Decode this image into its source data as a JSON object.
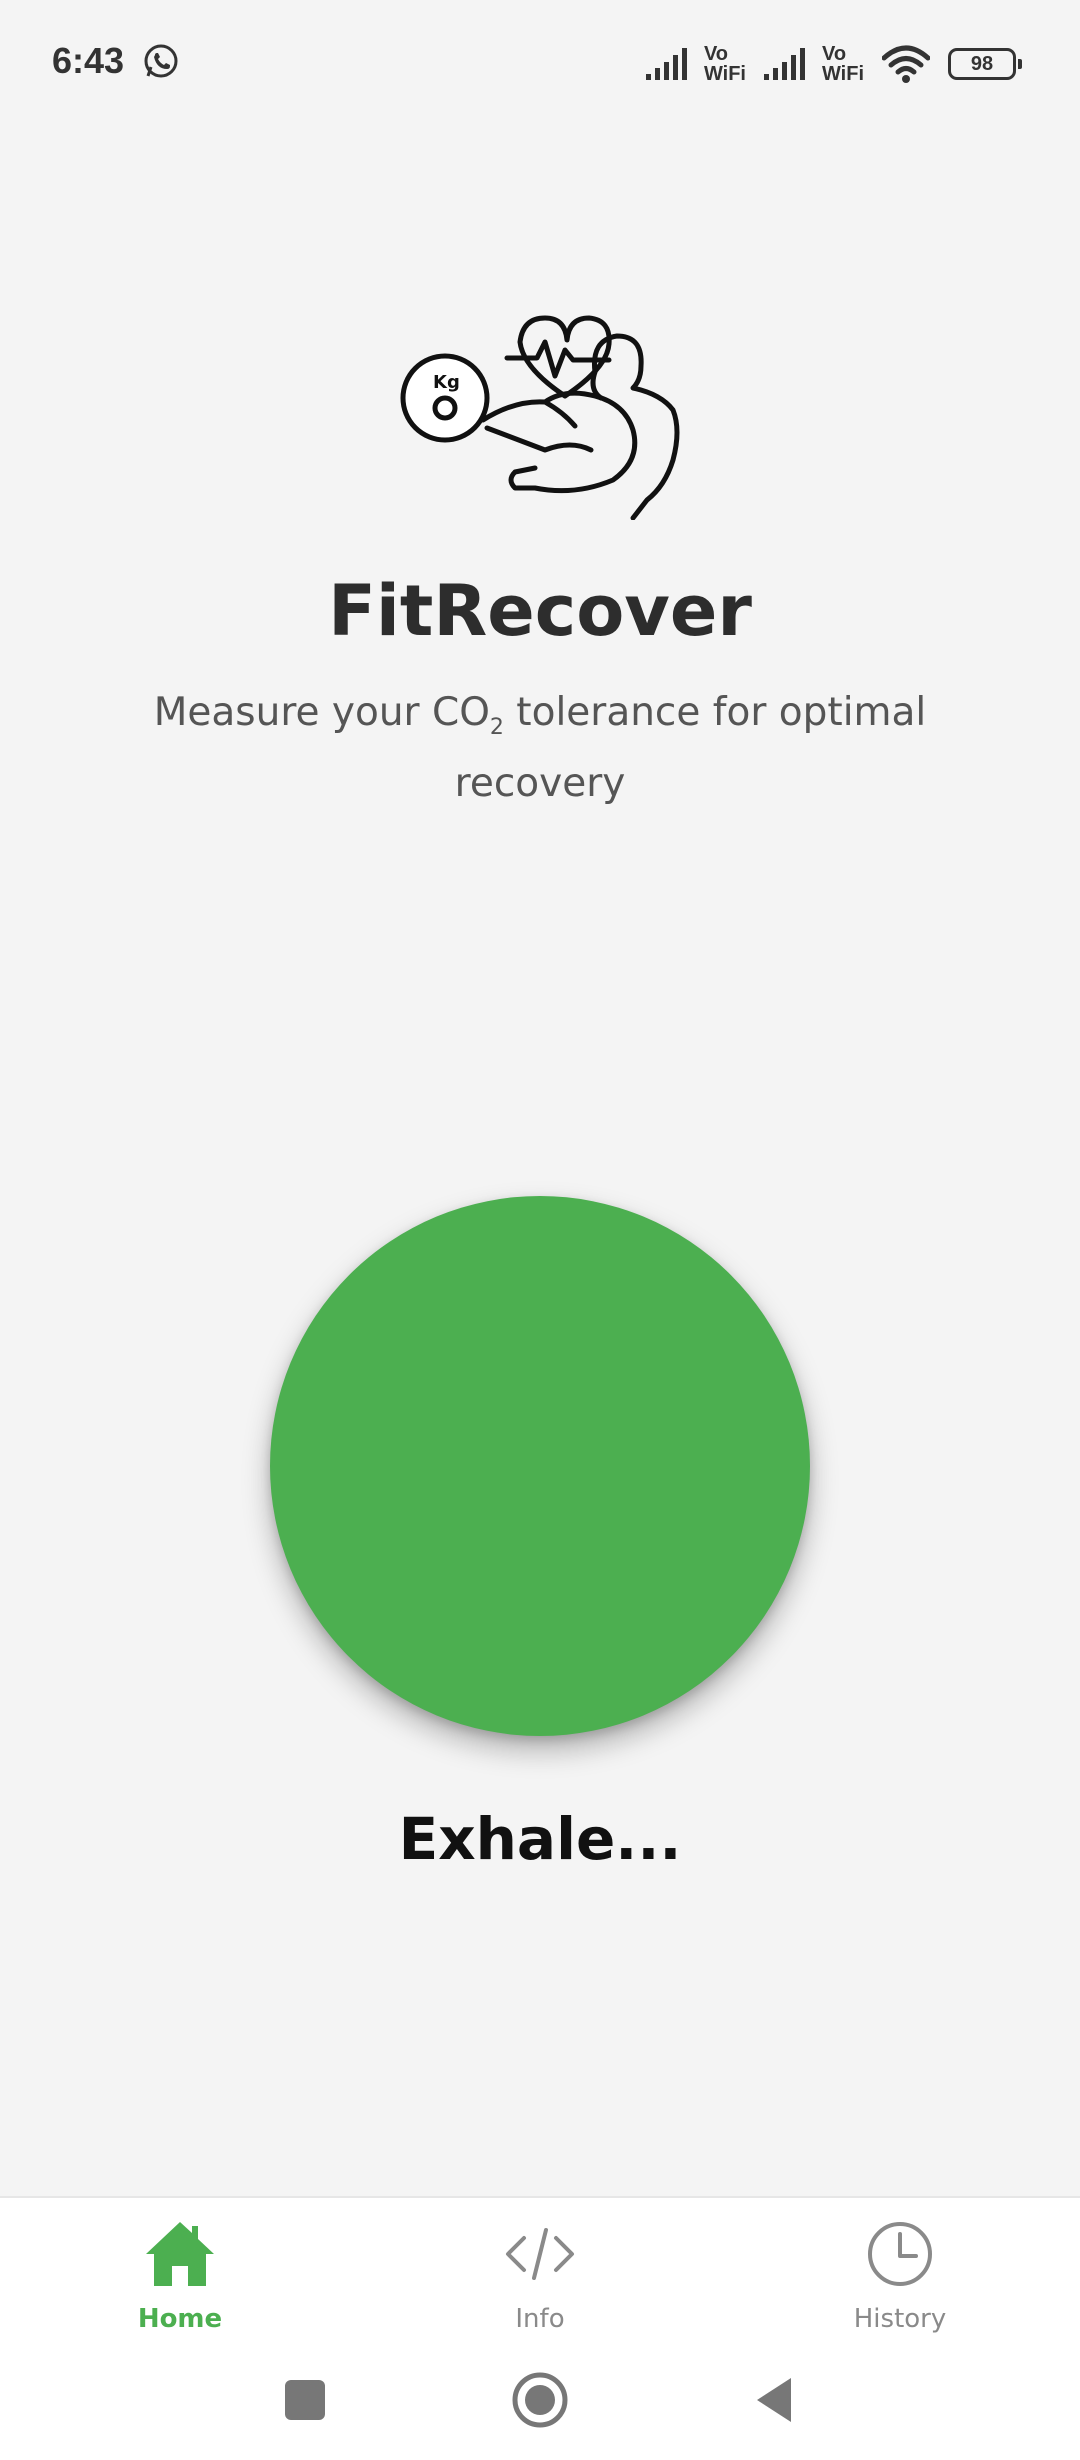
{
  "status_bar": {
    "time": "6:43",
    "network_1": [
      "Vo",
      "WiFi"
    ],
    "network_2": [
      "Vo",
      "WiFi"
    ],
    "battery": "98",
    "icons": [
      "whatsapp-icon",
      "signal-icon",
      "wifi-icon",
      "battery-icon"
    ]
  },
  "header": {
    "title": "FitRecover",
    "subtitle_pre": "Measure your CO",
    "subtitle_sub": "2",
    "subtitle_post": " tolerance for optimal recovery",
    "logo_text": "Kg"
  },
  "breath": {
    "status": "Exhale...",
    "circle_color": "#4caf50"
  },
  "bottom_nav": {
    "active_color": "#4caf50",
    "inactive_color": "#8a8a8a",
    "items": [
      {
        "label": "Home",
        "icon": "home-icon",
        "active": true
      },
      {
        "label": "Info",
        "icon": "code-icon",
        "active": false
      },
      {
        "label": "History",
        "icon": "clock-icon",
        "active": false
      }
    ]
  },
  "system_nav": {
    "buttons": [
      "recents-button",
      "home-button",
      "back-button"
    ]
  }
}
